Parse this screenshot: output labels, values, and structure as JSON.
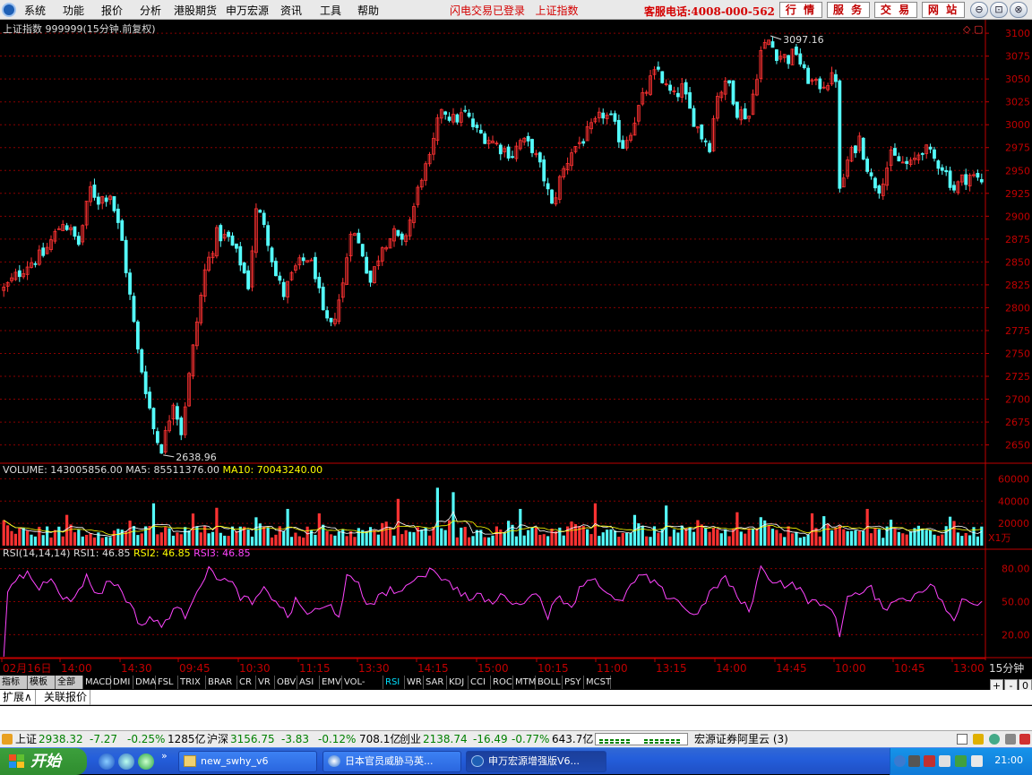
{
  "menubar": {
    "items": [
      "系统",
      "功能",
      "报价",
      "分析",
      "港股期货",
      "申万宏源",
      "资讯",
      "工具",
      "帮助"
    ],
    "flash_status": "闪电交易已登录",
    "flash_index": "上证指数",
    "hotline": "客服电话:4008-000-562",
    "buttons": [
      "行 情",
      "服 务",
      "交 易",
      "网 站"
    ],
    "window_buttons": [
      "⊖",
      "⊡",
      "⊗"
    ]
  },
  "colors": {
    "up": "#ff3232",
    "down": "#54fcfc",
    "grid": "#8a0000",
    "axis": "#c00000",
    "ma5": "#ffffff",
    "ma10": "#ffff00",
    "rsi": "#ff44ff"
  },
  "chart_data": {
    "type": "candlestick",
    "title": "上证指数",
    "code": "999999",
    "period_label": "(15分钟.前复权)",
    "y_ticks": [
      3100,
      3075,
      3050,
      3025,
      3000,
      2975,
      2950,
      2925,
      2900,
      2875,
      2850,
      2825,
      2800,
      2775,
      2750,
      2725,
      2700,
      2675,
      2650
    ],
    "ylim": [
      2631,
      3105
    ],
    "high_label": "3097.16",
    "low_label": "2638.96",
    "close_path": [
      [
        0,
        2820
      ],
      [
        6,
        2848
      ],
      [
        10,
        2858
      ],
      [
        15,
        2895
      ],
      [
        19,
        2870
      ],
      [
        22,
        2930
      ],
      [
        24,
        2918
      ],
      [
        27,
        2925
      ],
      [
        30,
        2872
      ],
      [
        34,
        2752
      ],
      [
        36,
        2712
      ],
      [
        38,
        2668
      ],
      [
        40,
        2642
      ],
      [
        43,
        2700
      ],
      [
        45,
        2665
      ],
      [
        49,
        2785
      ],
      [
        51,
        2840
      ],
      [
        54,
        2880
      ],
      [
        57,
        2875
      ],
      [
        60,
        2850
      ],
      [
        62,
        2825
      ],
      [
        64,
        2905
      ],
      [
        66,
        2895
      ],
      [
        69,
        2835
      ],
      [
        71,
        2815
      ],
      [
        74,
        2843
      ],
      [
        77,
        2855
      ],
      [
        79,
        2838
      ],
      [
        81,
        2790
      ],
      [
        83,
        2778
      ],
      [
        86,
        2825
      ],
      [
        88,
        2888
      ],
      [
        91,
        2860
      ],
      [
        93,
        2828
      ],
      [
        96,
        2870
      ],
      [
        99,
        2880
      ],
      [
        101,
        2868
      ],
      [
        104,
        2910
      ],
      [
        106,
        2945
      ],
      [
        108,
        2960
      ],
      [
        111,
        3020
      ],
      [
        114,
        3005
      ],
      [
        117,
        3012
      ],
      [
        120,
        2992
      ],
      [
        123,
        2985
      ],
      [
        126,
        2975
      ],
      [
        129,
        2968
      ],
      [
        131,
        2982
      ],
      [
        134,
        2975
      ],
      [
        137,
        2942
      ],
      [
        139,
        2910
      ],
      [
        141,
        2940
      ],
      [
        144,
        2972
      ],
      [
        147,
        2985
      ],
      [
        149,
        2995
      ],
      [
        152,
        3012
      ],
      [
        154,
        3005
      ],
      [
        157,
        2978
      ],
      [
        159,
        2995
      ],
      [
        161,
        3018
      ],
      [
        164,
        3048
      ],
      [
        166,
        3060
      ],
      [
        168,
        3040
      ],
      [
        170,
        3030
      ],
      [
        172,
        3040
      ],
      [
        174,
        3015
      ],
      [
        177,
        2988
      ],
      [
        179,
        2978
      ],
      [
        181,
        3035
      ],
      [
        184,
        3045
      ],
      [
        186,
        3015
      ],
      [
        189,
        3010
      ],
      [
        192,
        3080
      ],
      [
        194,
        3092
      ],
      [
        196,
        3078
      ],
      [
        199,
        3072
      ],
      [
        201,
        3080
      ],
      [
        203,
        3055
      ],
      [
        206,
        3042
      ],
      [
        209,
        3048
      ],
      [
        211,
        3052
      ],
      [
        212,
        2925
      ],
      [
        214,
        2960
      ],
      [
        217,
        2985
      ],
      [
        220,
        2940
      ],
      [
        222,
        2932
      ],
      [
        225,
        2965
      ],
      [
        228,
        2958
      ],
      [
        230,
        2955
      ],
      [
        233,
        2975
      ],
      [
        236,
        2962
      ],
      [
        238,
        2955
      ],
      [
        241,
        2930
      ],
      [
        243,
        2940
      ],
      [
        245,
        2945
      ],
      [
        248,
        2938
      ]
    ],
    "high": 3097.16,
    "low": 2638.96,
    "x_labels": [
      "02月16日",
      "14:00",
      "14:30",
      "09:45",
      "10:30",
      "11:15",
      "13:30",
      "14:15",
      "15:00",
      "10:15",
      "11:00",
      "13:15",
      "14:00",
      "14:45",
      "10:00",
      "10:45",
      "13:00"
    ],
    "period": "15分钟",
    "volume": {
      "label": "VOLUME:",
      "value": "143005856.00",
      "ma5_label": "MA5:",
      "ma5": "85511376.00",
      "ma10_label": "MA10:",
      "ma10": "70043240.00",
      "y_ticks": [
        60000,
        40000,
        20000
      ],
      "unit": "X1万",
      "ylim": [
        0,
        70000
      ],
      "spikes": [
        [
          38,
          38000
        ],
        [
          54,
          34000
        ],
        [
          72,
          33000
        ],
        [
          100,
          42000
        ],
        [
          110,
          52000
        ],
        [
          114,
          48000
        ],
        [
          131,
          33000
        ],
        [
          150,
          38000
        ],
        [
          168,
          36000
        ],
        [
          186,
          30000
        ],
        [
          205,
          29000
        ],
        [
          219,
          33000
        ],
        [
          240,
          26000
        ]
      ]
    },
    "rsi": {
      "label": "RSI(14,14,14)",
      "rsi1_label": "RSI1:",
      "rsi1": "46.85",
      "rsi2_label": "RSI2:",
      "rsi2": "46.85",
      "rsi3_label": "RSI3:",
      "rsi3": "46.85",
      "y_ticks": [
        80.0,
        50.0,
        20.0
      ],
      "ylim": [
        0,
        96
      ],
      "path": [
        [
          0,
          0
        ],
        [
          1,
          55
        ],
        [
          3,
          70
        ],
        [
          6,
          76
        ],
        [
          9,
          62
        ],
        [
          12,
          74
        ],
        [
          15,
          55
        ],
        [
          17,
          48
        ],
        [
          19,
          62
        ],
        [
          21,
          72
        ],
        [
          24,
          56
        ],
        [
          27,
          70
        ],
        [
          30,
          60
        ],
        [
          33,
          40
        ],
        [
          35,
          28
        ],
        [
          37,
          36
        ],
        [
          40,
          27
        ],
        [
          43,
          44
        ],
        [
          46,
          38
        ],
        [
          49,
          62
        ],
        [
          52,
          78
        ],
        [
          55,
          72
        ],
        [
          58,
          65
        ],
        [
          60,
          55
        ],
        [
          63,
          48
        ],
        [
          66,
          60
        ],
        [
          69,
          52
        ],
        [
          72,
          36
        ],
        [
          74,
          50
        ],
        [
          77,
          40
        ],
        [
          80,
          42
        ],
        [
          83,
          46
        ],
        [
          85,
          38
        ],
        [
          87,
          72
        ],
        [
          90,
          64
        ],
        [
          92,
          48
        ],
        [
          95,
          53
        ],
        [
          98,
          62
        ],
        [
          101,
          56
        ],
        [
          104,
          72
        ],
        [
          107,
          76
        ],
        [
          109,
          81
        ],
        [
          112,
          68
        ],
        [
          115,
          62
        ],
        [
          118,
          52
        ],
        [
          121,
          55
        ],
        [
          124,
          48
        ],
        [
          127,
          58
        ],
        [
          130,
          45
        ],
        [
          133,
          56
        ],
        [
          136,
          55
        ],
        [
          138,
          38
        ],
        [
          141,
          55
        ],
        [
          144,
          46
        ],
        [
          147,
          68
        ],
        [
          150,
          72
        ],
        [
          153,
          56
        ],
        [
          156,
          48
        ],
        [
          159,
          64
        ],
        [
          162,
          74
        ],
        [
          165,
          66
        ],
        [
          168,
          56
        ],
        [
          171,
          52
        ],
        [
          174,
          38
        ],
        [
          177,
          44
        ],
        [
          180,
          62
        ],
        [
          183,
          72
        ],
        [
          186,
          54
        ],
        [
          189,
          42
        ],
        [
          192,
          80
        ],
        [
          195,
          70
        ],
        [
          198,
          66
        ],
        [
          201,
          64
        ],
        [
          204,
          52
        ],
        [
          207,
          46
        ],
        [
          210,
          46
        ],
        [
          212,
          18
        ],
        [
          214,
          58
        ],
        [
          217,
          56
        ],
        [
          220,
          62
        ],
        [
          223,
          42
        ],
        [
          226,
          54
        ],
        [
          229,
          50
        ],
        [
          232,
          60
        ],
        [
          235,
          66
        ],
        [
          238,
          50
        ],
        [
          241,
          30
        ],
        [
          243,
          52
        ],
        [
          246,
          50
        ],
        [
          248,
          50
        ]
      ]
    },
    "series": [
      {
        "name": "RSI1"
      },
      {
        "name": "RSI2"
      },
      {
        "name": "RSI3"
      }
    ]
  },
  "indicator_tabs": [
    "指标",
    "模板",
    "全部",
    "MACD",
    "DMI",
    "DMA",
    "FSL",
    "TRIX",
    "BRAR",
    "CR",
    "VR",
    "OBV",
    "ASI",
    "EMV",
    "VOL-TDX",
    "RSI",
    "WR",
    "SAR",
    "KDJ",
    "CCI",
    "ROC",
    "MTM",
    "BOLL",
    "PSY",
    "MCST"
  ],
  "indicator_tab_selected": "RSI",
  "tab_controls": [
    "+",
    "-",
    "0"
  ],
  "ext_tabs": [
    "扩展∧",
    "关联报价"
  ],
  "statusbar": {
    "sh_label": "上证",
    "sh_value": "2938.32",
    "sh_change": "-7.27",
    "sh_pct": "-0.25%",
    "sh_amount": "1285亿",
    "hs_label": "沪深",
    "hs_value": "3156.75",
    "hs_change": "-3.83",
    "hs_pct": "-0.12%",
    "hs_amount": "708.1亿",
    "cy_label": "创业",
    "cy_value": "2138.74",
    "cy_change": "-16.49",
    "cy_pct": "-0.77%",
    "cy_amount": "643.7亿",
    "server": "宏源证券阿里云 (3)"
  },
  "taskbar": {
    "start": "开始",
    "tasks": [
      "new_swhy_v6",
      "日本官员威胁马英...",
      "申万宏源增强版V6..."
    ],
    "clock": "21:00"
  }
}
